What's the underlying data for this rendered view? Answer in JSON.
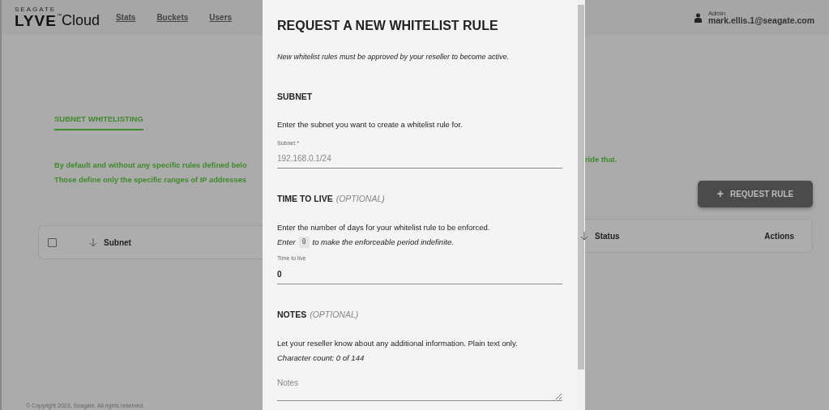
{
  "header": {
    "brand_top": "SEAGATE",
    "brand": "LYVE",
    "brand_tm": "™",
    "brand_suffix": "Cloud",
    "nav": [
      {
        "label": "Stats"
      },
      {
        "label": "Buckets"
      },
      {
        "label": "Users"
      }
    ],
    "user": {
      "role": "Admin",
      "email": "mark.ellis.1@seagate.com"
    }
  },
  "page": {
    "tabs": [
      {
        "label": "SUBNET WHITELISTING",
        "selected": true
      }
    ],
    "intro_left": [
      "By default and without any specific rules defined belo",
      "Those define only the specific ranges of IP addresses"
    ],
    "intro_right": [
      "ride that."
    ],
    "request_button": {
      "icon": "+",
      "label": "REQUEST RULE"
    },
    "table": {
      "select_all_checked": false,
      "columns": [
        {
          "label": "Subnet",
          "sorted": true
        },
        {
          "label": "Status",
          "sorted": true
        },
        {
          "label": "Actions",
          "sorted": false
        }
      ]
    },
    "footer": "© Copyright 2023, Seagate. All rights reserved."
  },
  "modal": {
    "title": "REQUEST A NEW WHITELIST RULE",
    "subtitle": "New whitelist rules must be approved by your reseller to become active.",
    "sections": [
      {
        "kind": "input",
        "heading": "SUBNET",
        "description": "Enter the subnet you want to create a whitelist rule for.",
        "field_label": "Subnet *",
        "placeholder": "192.168.0.1/24"
      },
      {
        "kind": "input",
        "heading": "TIME TO LIVE",
        "optional": "(OPTIONAL)",
        "description": "Enter the number of days for your whitelist rule to be enforced.",
        "hint": [
          "Enter",
          "0",
          "to make the enforceable period indefinite."
        ],
        "field_label": "Time to live",
        "value": "0"
      },
      {
        "kind": "textarea",
        "heading": "NOTES",
        "optional": "(OPTIONAL)",
        "description": "Let your reseller know about any additional information. Plain text only.",
        "count": "Character count: 0 of 144",
        "placeholder": "Notes"
      }
    ]
  }
}
